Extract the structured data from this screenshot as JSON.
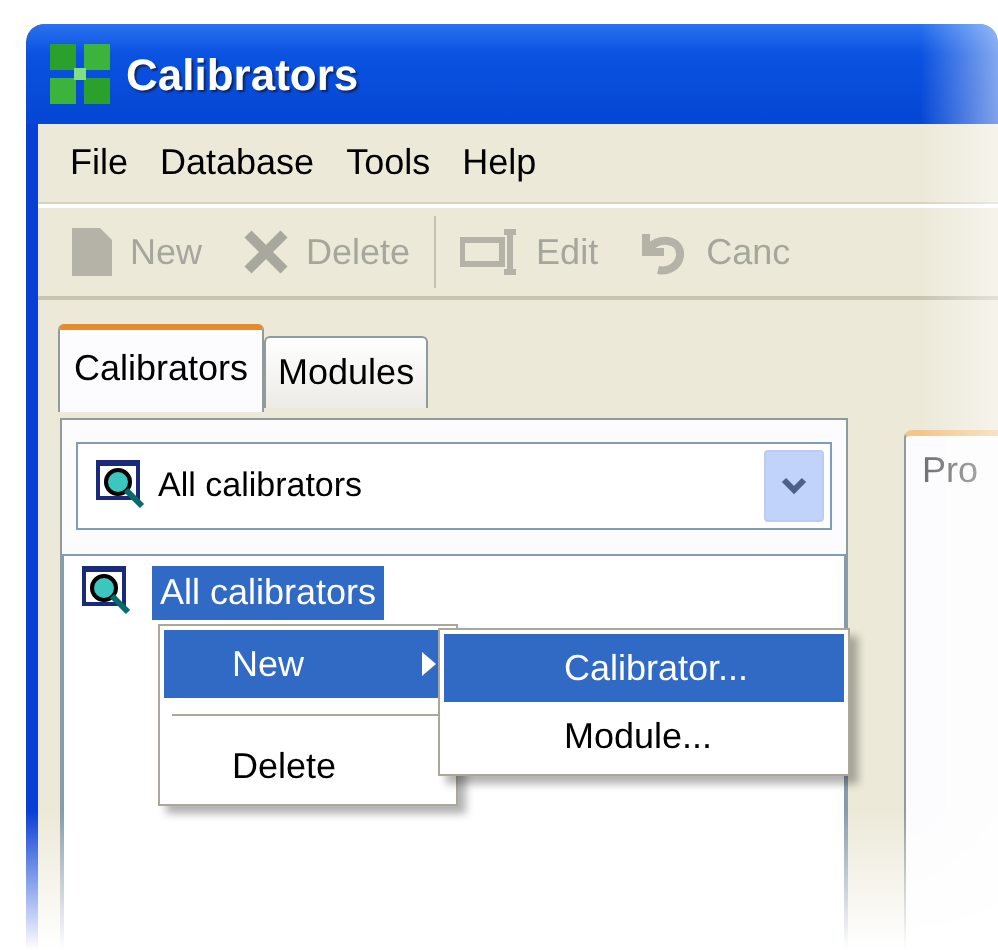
{
  "window": {
    "title": "Calibrators"
  },
  "menu_bar": [
    "File",
    "Database",
    "Tools",
    "Help"
  ],
  "toolbar": [
    {
      "label": "New",
      "kind": "page",
      "disabled": true
    },
    {
      "label": "Delete",
      "kind": "cross",
      "disabled": true
    },
    {
      "label": "Edit",
      "kind": "edit",
      "disabled": true
    },
    {
      "label": "Canc",
      "kind": "undo",
      "disabled": true
    }
  ],
  "left_panel": {
    "tabs": [
      {
        "label": "Calibrators",
        "selected": true
      },
      {
        "label": "Modules",
        "selected": false
      }
    ],
    "filter": {
      "value": "All calibrators"
    },
    "tree": [
      {
        "label": "All calibrators",
        "selected": true
      }
    ]
  },
  "context_menu": [
    {
      "label": "New",
      "selected": true,
      "submenu": true
    },
    {
      "kind": "separator"
    },
    {
      "label": "Delete",
      "selected": false,
      "submenu": false
    }
  ],
  "submenu": [
    {
      "label": "Calibrator...",
      "selected": true
    },
    {
      "label": "Module...",
      "selected": false
    }
  ],
  "right_panel": {
    "tab": "Pro"
  }
}
